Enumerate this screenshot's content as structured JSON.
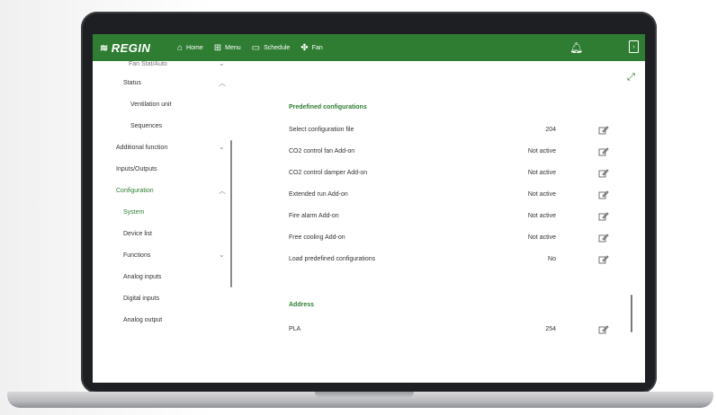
{
  "topbar": {
    "brand": "REGIN",
    "nav": [
      {
        "label": "Home",
        "icon": "home-icon"
      },
      {
        "label": "Menu",
        "icon": "grid-icon"
      },
      {
        "label": "Schedule",
        "icon": "calendar-icon"
      },
      {
        "label": "Fan",
        "icon": "fan-icon"
      }
    ]
  },
  "sidebar": {
    "items": [
      {
        "label": "Fan Stat/Auto"
      },
      {
        "label": "Status"
      },
      {
        "label": "Ventilation unit"
      },
      {
        "label": "Sequences"
      },
      {
        "label": "Additional function"
      },
      {
        "label": "Inputs/Outputs"
      },
      {
        "label": "Configuration"
      },
      {
        "label": "System"
      },
      {
        "label": "Device list"
      },
      {
        "label": "Functions"
      },
      {
        "label": "Analog inputs"
      },
      {
        "label": "Digital inputs"
      },
      {
        "label": "Analog output"
      }
    ]
  },
  "main": {
    "sections": [
      {
        "title": "Predefined configurations",
        "rows": [
          {
            "label": "Select configuration file",
            "value": "204"
          },
          {
            "label": "CO2 control fan Add-on",
            "value": "Not active"
          },
          {
            "label": "CO2 control damper Add-on",
            "value": "Not active"
          },
          {
            "label": "Extended run Add-on",
            "value": "Not active"
          },
          {
            "label": "Fire alarm Add-on",
            "value": "Not active"
          },
          {
            "label": "Free cooling Add-on",
            "value": "Not active"
          },
          {
            "label": "Load predefined configurations",
            "value": "No"
          }
        ]
      },
      {
        "title": "Address",
        "rows": [
          {
            "label": "PLA",
            "value": "254"
          }
        ]
      }
    ]
  },
  "colors": {
    "brand_green": "#2e7d32",
    "text": "#333333"
  }
}
